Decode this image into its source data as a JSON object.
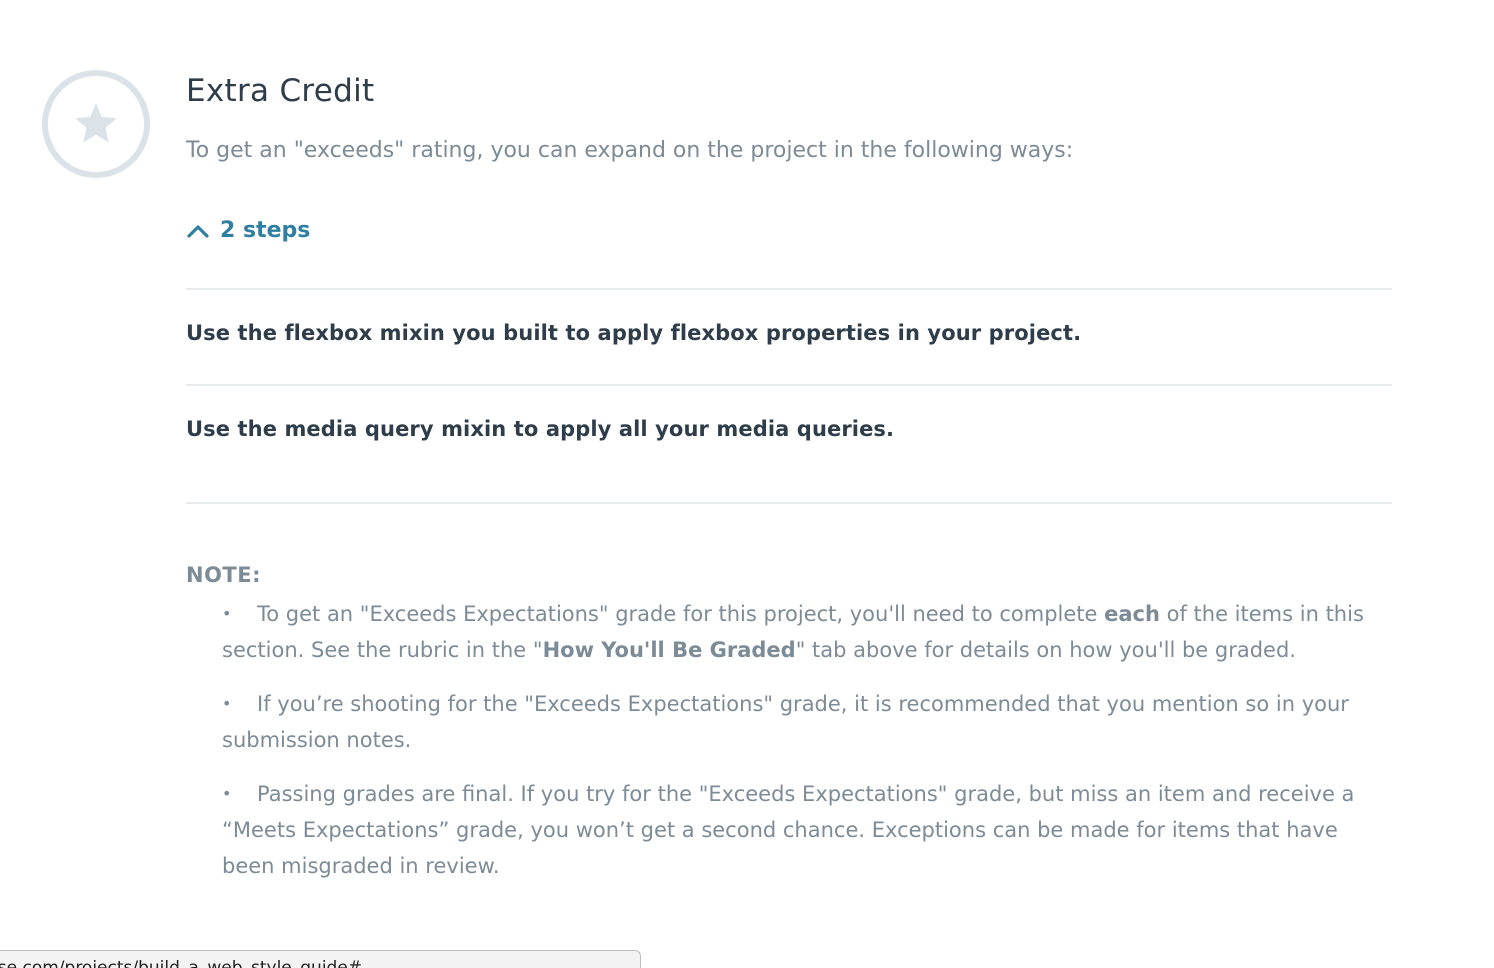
{
  "section": {
    "icon": "star-icon",
    "title": "Extra Credit",
    "subtitle": "To get an \"exceeds\" rating, you can expand on the project in the following ways:",
    "steps_toggle": {
      "icon": "chevron-up-icon",
      "label": "2 steps"
    },
    "steps": [
      {
        "text": "Use the flexbox mixin you built to apply flexbox properties in your project."
      },
      {
        "text": "Use the media query mixin to apply all your media queries."
      }
    ]
  },
  "note": {
    "heading": "NOTE:",
    "bullet": "•",
    "items": [
      {
        "part1": "To get an \"Exceeds Expectations\" grade for this project, you'll need to complete ",
        "bold1": "each",
        "part2": " of the items in this section. See the rubric in the \"",
        "bold2": "How You'll Be Graded",
        "part3": "\" tab above for details on how you'll be graded."
      },
      {
        "text": "If you’re shooting for the \"Exceeds Expectations\" grade, it is recommended that you mention so in your submission notes."
      },
      {
        "text": "Passing grades are final. If you try for the \"Exceeds Expectations\" grade, but miss an item and receive a “Meets Expectations” grade, you won’t get a second chance. Exceptions can be made for items that have been misgraded in review."
      }
    ]
  },
  "status_bar": {
    "url": "use.com/projects/build_a_web_style_guide#"
  },
  "colors": {
    "accent": "#2f7fa3",
    "heading": "#2e3d49",
    "muted": "#7d8b97",
    "badge_ring": "#dbe2e8"
  }
}
